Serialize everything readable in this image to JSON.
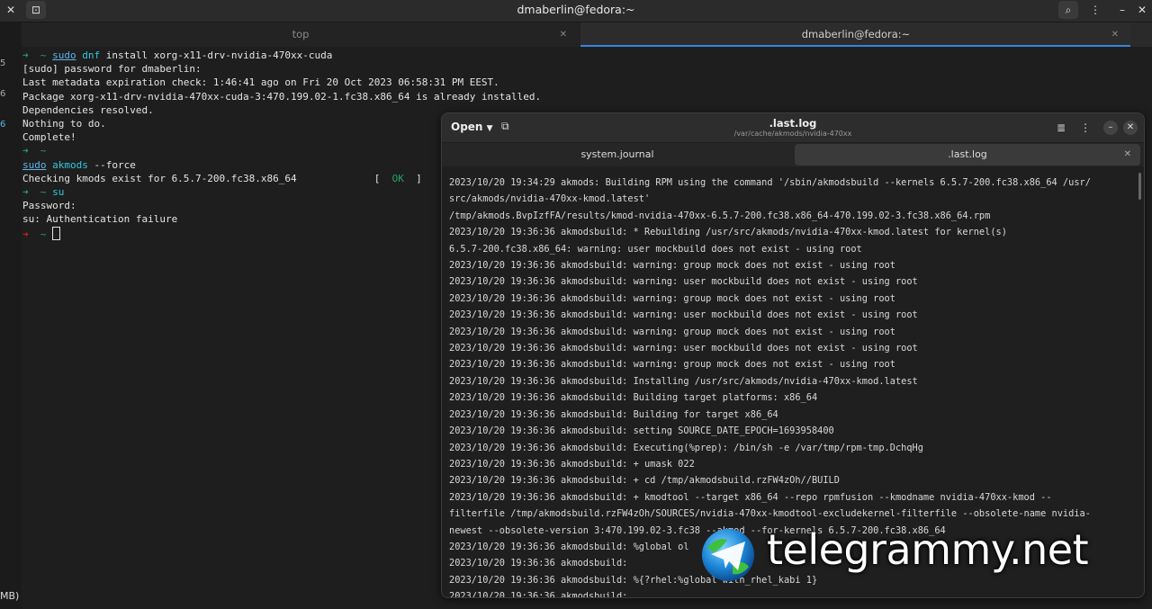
{
  "window": {
    "title": "dmaberlin@fedora:~"
  },
  "tabs": [
    {
      "label": "top"
    },
    {
      "label": "dmaberlin@fedora:~"
    }
  ],
  "edge_marks": [
    "5",
    "6",
    "6"
  ],
  "terminal": {
    "lines": {
      "l1_cmd_sudo": "sudo",
      "l1_cmd_dnf": "dnf",
      "l1_cmd_rest": " install xorg-x11-drv-nvidia-470xx-cuda",
      "l2": "[sudo] password for dmaberlin:",
      "l3": "Last metadata expiration check: 1:46:41 ago on Fri 20 Oct 2023 06:58:31 PM EEST.",
      "l4": "Package xorg-x11-drv-nvidia-470xx-cuda-3:470.199.02-1.fc38.x86_64 is already installed.",
      "l5": "Dependencies resolved.",
      "l6": "Nothing to do.",
      "l7": "Complete!",
      "l9_sudo": "sudo",
      "l9_akmods": "akmods",
      "l9_rest": " --force",
      "l10": "Checking kmods exist for 6.5.7-200.fc38.x86_64",
      "l10_ok": "OK",
      "l11_cmd": "su",
      "l12": "Password:",
      "l13": "su: Authentication failure"
    },
    "prompt_arrow": "➜",
    "prompt_tilde": "~"
  },
  "footer_left": "MB)",
  "viewer": {
    "open_label": "Open",
    "title": ".last.log",
    "subtitle": "/var/cache/akmods/nvidia-470xx",
    "tabs": [
      {
        "label": "system.journal"
      },
      {
        "label": ".last.log"
      }
    ],
    "log_lines": [
      "2023/10/20 19:34:29 akmods: Building RPM using the command '/sbin/akmodsbuild --kernels 6.5.7-200.fc38.x86_64 /usr/",
      "src/akmods/nvidia-470xx-kmod.latest'",
      "/tmp/akmods.BvpIzfFA/results/kmod-nvidia-470xx-6.5.7-200.fc38.x86_64-470.199.02-3.fc38.x86_64.rpm",
      "2023/10/20 19:36:36 akmodsbuild: * Rebuilding /usr/src/akmods/nvidia-470xx-kmod.latest for kernel(s)",
      "6.5.7-200.fc38.x86_64: warning: user mockbuild does not exist - using root",
      "2023/10/20 19:36:36 akmodsbuild: warning: group mock does not exist - using root",
      "2023/10/20 19:36:36 akmodsbuild: warning: user mockbuild does not exist - using root",
      "2023/10/20 19:36:36 akmodsbuild: warning: group mock does not exist - using root",
      "2023/10/20 19:36:36 akmodsbuild: warning: user mockbuild does not exist - using root",
      "2023/10/20 19:36:36 akmodsbuild: warning: group mock does not exist - using root",
      "2023/10/20 19:36:36 akmodsbuild: warning: user mockbuild does not exist - using root",
      "2023/10/20 19:36:36 akmodsbuild: warning: group mock does not exist - using root",
      "2023/10/20 19:36:36 akmodsbuild: Installing /usr/src/akmods/nvidia-470xx-kmod.latest",
      "2023/10/20 19:36:36 akmodsbuild: Building target platforms: x86_64",
      "2023/10/20 19:36:36 akmodsbuild: Building for target x86_64",
      "2023/10/20 19:36:36 akmodsbuild: setting SOURCE_DATE_EPOCH=1693958400",
      "2023/10/20 19:36:36 akmodsbuild: Executing(%prep): /bin/sh -e /var/tmp/rpm-tmp.DchqHg",
      "2023/10/20 19:36:36 akmodsbuild: + umask 022",
      "2023/10/20 19:36:36 akmodsbuild: + cd /tmp/akmodsbuild.rzFW4zOh//BUILD",
      "2023/10/20 19:36:36 akmodsbuild: + kmodtool --target x86_64 --repo rpmfusion --kmodname nvidia-470xx-kmod --",
      "filterfile /tmp/akmodsbuild.rzFW4zOh/SOURCES/nvidia-470xx-kmodtool-excludekernel-filterfile --obsolete-name nvidia-",
      "newest --obsolete-version 3:470.199.02-3.fc38 --akmod --for-kernels 6.5.7-200.fc38.x86_64",
      "2023/10/20 19:36:36 akmodsbuild: %global ol",
      "2023/10/20 19:36:36 akmodsbuild:",
      "2023/10/20 19:36:36 akmodsbuild: %{?rhel:%global with_rhel_kabi 1}",
      "2023/10/20 19:36:36 akmodsbuild:"
    ]
  },
  "watermark": {
    "text": "telegrammy.net"
  },
  "colors": {
    "accent": "#3584e4",
    "prompt_green": "#26a269",
    "prompt_red": "#e01b24",
    "ok": "#33c7de"
  }
}
